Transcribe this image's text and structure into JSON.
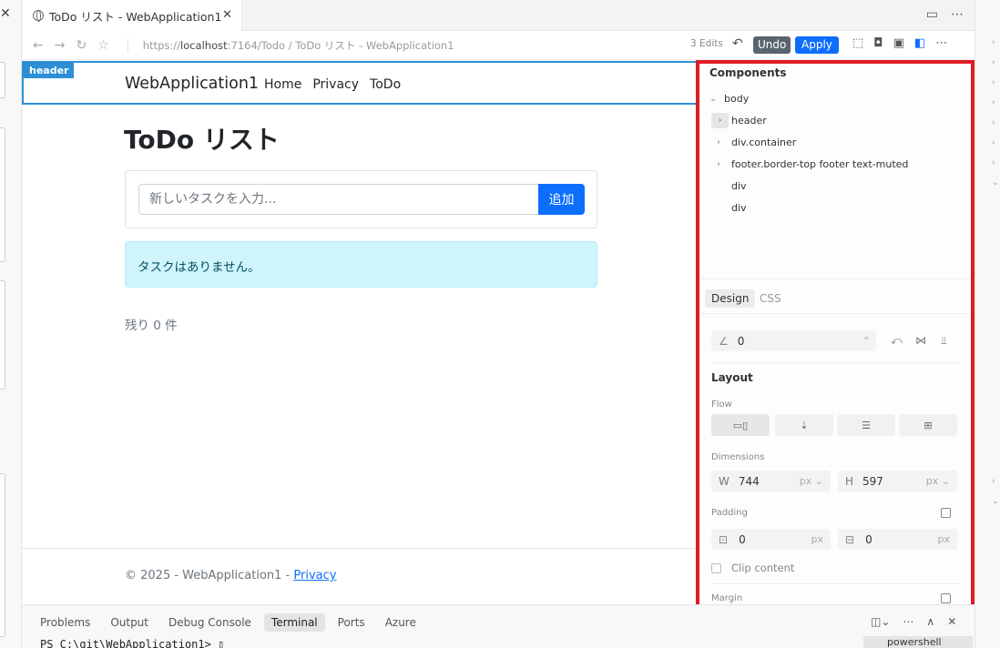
{
  "tab": {
    "title": "ToDo リスト - WebApplication1"
  },
  "addressbar": {
    "url_prefix": "https://",
    "url_host": "localhost",
    "url_rest": ":7164/Todo / ToDo リスト - WebApplication1",
    "edits": "3 Edits",
    "undo_label": "Undo",
    "apply_label": "Apply"
  },
  "page": {
    "header_tag": "header",
    "brand": "WebApplication1",
    "nav": [
      "Home",
      "Privacy",
      "ToDo"
    ],
    "heading": "ToDo リスト",
    "input_placeholder": "新しいタスクを入力...",
    "add_button": "追加",
    "empty_message": "タスクはありません。",
    "remaining": "残り 0 件",
    "footer_text": "© 2025 - WebApplication1 - ",
    "footer_link": "Privacy"
  },
  "inspector": {
    "components_title": "Components",
    "tree": [
      {
        "label": "body",
        "level": 0,
        "expander": "open"
      },
      {
        "label": "header",
        "level": 1,
        "expander": "boxed"
      },
      {
        "label": "div.container",
        "level": 1,
        "expander": "closed"
      },
      {
        "label": "footer.border-top footer text-muted",
        "level": 1,
        "expander": "closed"
      },
      {
        "label": "div",
        "level": 1,
        "expander": "none"
      },
      {
        "label": "div",
        "level": 1,
        "expander": "none"
      }
    ],
    "tabs": {
      "design": "Design",
      "css": "CSS"
    },
    "rotation": {
      "value": "0",
      "unit": "°"
    },
    "layout_title": "Layout",
    "flow_label": "Flow",
    "dimensions_label": "Dimensions",
    "width": {
      "label": "W",
      "value": "744",
      "unit": "px"
    },
    "height": {
      "label": "H",
      "value": "597",
      "unit": "px"
    },
    "padding_label": "Padding",
    "padding_h": {
      "value": "0",
      "unit": "px"
    },
    "padding_v": {
      "value": "0",
      "unit": "px"
    },
    "clip_label": "Clip content",
    "margin_label": "Margin"
  },
  "bottom_panel": {
    "tabs": [
      "Problems",
      "Output",
      "Debug Console",
      "Terminal",
      "Ports",
      "Azure"
    ],
    "active_tab": "Terminal",
    "prompt": "PS C:\\git\\WebApplication1> ",
    "terminal_name": "powershell"
  },
  "colors": {
    "accent": "#0d6efd",
    "highlight": "#e01b24",
    "header_outline": "#2c8fd6"
  }
}
